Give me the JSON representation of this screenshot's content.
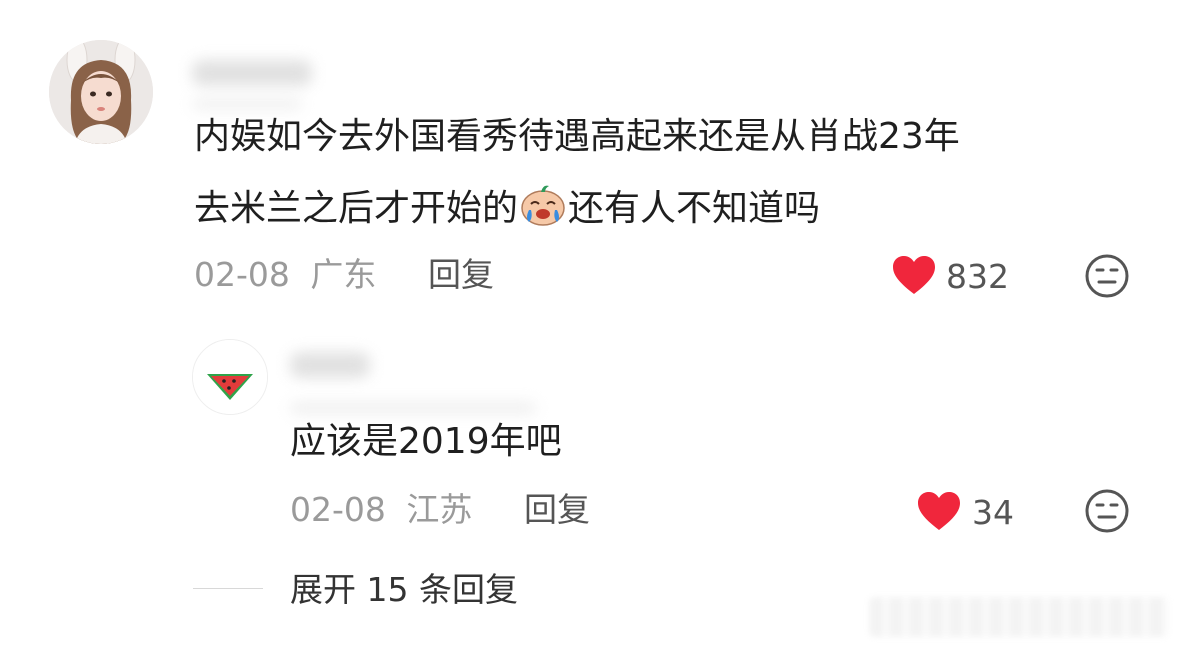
{
  "comment": {
    "avatar_icon": "user-avatar-photo",
    "text_line1": "内娱如今去外国看秀待遇高起来还是从肖战23年",
    "text_line2_before_emoji": "去米兰之后才开始的",
    "emoji_icon": "crying-face-emoji",
    "text_line2_after_emoji": "还有人不知道吗",
    "date": "02-08",
    "location": "广东",
    "reply_label": "回复",
    "like_count": "832",
    "like_icon": "heart-icon",
    "dislike_icon": "meh-face-icon"
  },
  "reply": {
    "avatar_icon": "watermelon-avatar",
    "text": "应该是2019年吧",
    "date": "02-08",
    "location": "江苏",
    "reply_label": "回复",
    "like_count": "34",
    "like_icon": "heart-icon",
    "dislike_icon": "meh-face-icon"
  },
  "expand_replies_label": "展开 15 条回复",
  "colors": {
    "heart": "#f0263c",
    "meta_gray": "#9a9a9a"
  }
}
